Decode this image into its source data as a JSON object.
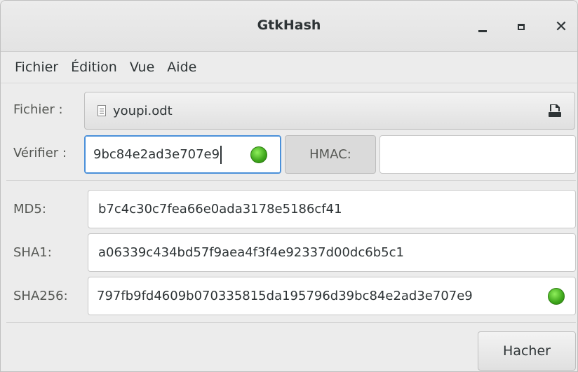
{
  "window": {
    "title": "GtkHash"
  },
  "menu": {
    "items": [
      "Fichier",
      "Édition",
      "Vue",
      "Aide"
    ]
  },
  "form": {
    "file_label": "Fichier :",
    "file_name": "youpi.odt",
    "verify_label": "Vérifier :",
    "verify_value": "9bc84e2ad3e707e9",
    "hmac_label": "HMAC:",
    "hmac_value": ""
  },
  "hashes": [
    {
      "label": "MD5:",
      "value": "b7c4c30c7fea66e0ada3178e5186cf41"
    },
    {
      "label": "SHA1:",
      "value": "a06339c434bd57f9aea4f3f4e92337d00dc6b5c1"
    },
    {
      "label": "SHA256:",
      "value": "797fb9fd4609b070335815da195796d39bc84e2ad3e707e9"
    }
  ],
  "actions": {
    "hash_button": "Hacher"
  },
  "colors": {
    "match_indicator": "#3ea61b",
    "focus_border": "#4a90d9"
  }
}
